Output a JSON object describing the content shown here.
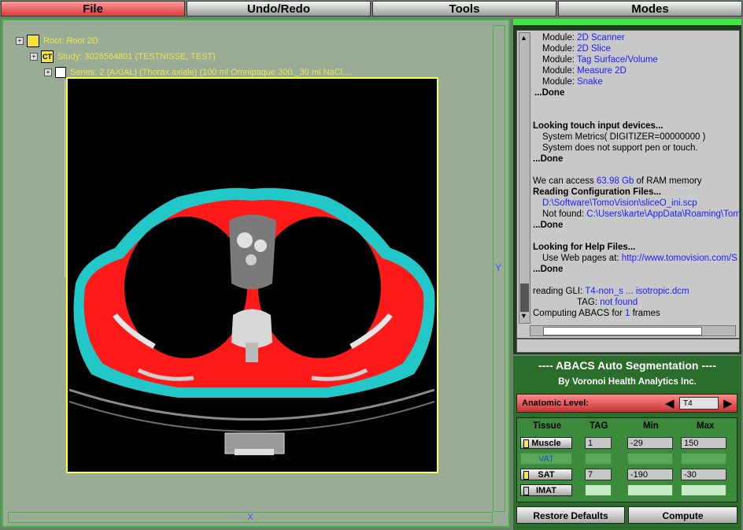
{
  "menubar": {
    "file": "File",
    "undo_redo": "Undo/Redo",
    "tools": "Tools",
    "modes": "Modes"
  },
  "tree": {
    "root": "Root: Root 2D",
    "study_icon": "CT",
    "study": "Study: 3026564801 (TESTNISSE, TEST)",
    "series": "Series: 2 (AXIAL) (Thorax axiale) (100 ml Omnipaque 300._30 ml NaCl...."
  },
  "viewer": {
    "y_label": "Y",
    "x_label": "X"
  },
  "console": {
    "lines": [
      {
        "prefix": "Module: ",
        "link": "2D Scanner"
      },
      {
        "prefix": "Module: ",
        "link": "2D Slice"
      },
      {
        "prefix": "Module: ",
        "link": "Tag Surface/Volume"
      },
      {
        "prefix": "Module: ",
        "link": "Measure 2D"
      },
      {
        "prefix": "Module: ",
        "link": "Snake"
      }
    ],
    "done1": "...Done",
    "touch_head": "Looking touch input devices...",
    "touch_1": "System Metrics( DIGITIZER=00000000 )",
    "touch_2": "System does not support pen or touch.",
    "done2": "...Done",
    "ram_pre": "We can access ",
    "ram_val": "63.98 Gb",
    "ram_post": " of RAM memory",
    "cfg_head": "Reading Configuration Files...",
    "cfg_path": "D:\\Software\\TomoVision\\sliceO_ini.scp",
    "cfg_nf_pre": "Not found: ",
    "cfg_nf": "C:\\Users\\karte\\AppData\\Roaming\\Tom",
    "done3": "...Done",
    "help_head": "Looking for Help Files...",
    "help_pre": "Use Web pages at: ",
    "help_url": "http://www.tomovision.com/S",
    "done4": "...Done",
    "read_pre": "reading      GLI:  ",
    "read_file": "T4-non_s ... isotropic.dcm",
    "tag_pre": "TAG:  ",
    "tag_val": "not found",
    "comp_pre": "Computing ABACS for ",
    "comp_n": "1",
    "comp_post": " frames"
  },
  "abacs": {
    "title": "---- ABACS Auto Segmentation ----",
    "subtitle": "By Voronoi Health Analytics Inc.",
    "level_label": "Anatomic Level:",
    "level_value": "T4",
    "headers": {
      "tissue": "Tissue",
      "tag": "TAG",
      "min": "Min",
      "max": "Max"
    },
    "rows": [
      {
        "name": "Muscle",
        "tag": "1",
        "min": "-29",
        "max": "150",
        "swatch": "#f4e84a"
      },
      {
        "name": "VAT",
        "tag": "",
        "min": "",
        "max": ""
      },
      {
        "name": "SAT",
        "tag": "7",
        "min": "-190",
        "max": "-30",
        "swatch": "#f4e84a"
      },
      {
        "name": "IMAT",
        "tag": "",
        "min": "",
        "max": "",
        "swatch": "#c8c8c8"
      }
    ],
    "restore": "Restore Defaults",
    "compute": "Compute"
  },
  "colors": {
    "muscle": "#ff1a1a",
    "sat": "#22c8c8",
    "frame": "#ffff40",
    "accent": "#42e642"
  }
}
